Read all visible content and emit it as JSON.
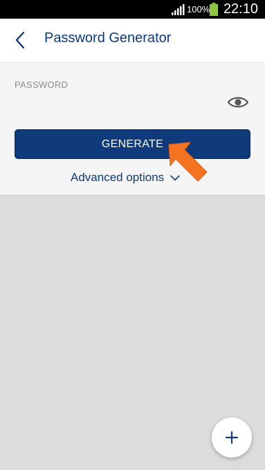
{
  "status_bar": {
    "battery_percent": "100%",
    "time": "22:10",
    "icons": [
      "signal-icon",
      "battery-icon"
    ]
  },
  "header": {
    "back_icon": "chevron-left-icon",
    "title": "Password Generator"
  },
  "generator": {
    "password_label": "PASSWORD",
    "password_value": "",
    "visibility_icon": "eye-icon",
    "generate_label": "GENERATE",
    "advanced_label": "Advanced options",
    "advanced_icon": "chevron-down-icon"
  },
  "annotation": {
    "arrow_icon": "arrow-pointer-icon",
    "color": "#f37321"
  },
  "fab": {
    "icon": "plus-icon"
  },
  "colors": {
    "brand": "#0f3a7c",
    "title_text": "#0d3a7a",
    "panel_bg": "#f5f5f5",
    "content_bg": "#dcdcdc",
    "battery": "#8dc63f"
  }
}
